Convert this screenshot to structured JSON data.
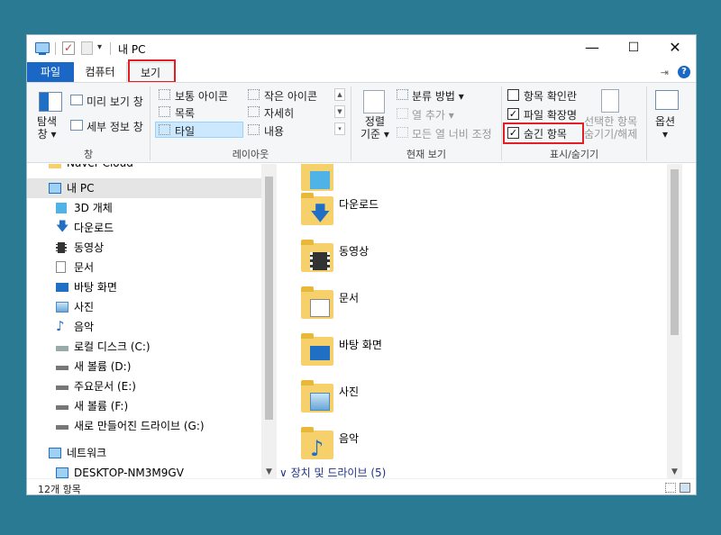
{
  "window": {
    "title": "내 PC"
  },
  "quick_access": {
    "pc_icon": "computer-icon",
    "check_icon": "checkmark-icon",
    "dropdown_glyph": "▾"
  },
  "controls": {
    "minimize": "—",
    "maximize": "☐",
    "close": "✕"
  },
  "tabs": [
    {
      "label": "파일",
      "active": false
    },
    {
      "label": "컴퓨터",
      "active": false
    },
    {
      "label": "보기",
      "active": true
    }
  ],
  "ribbon": {
    "pin_glyph": "⇥",
    "help_glyph": "?",
    "panes": {
      "nav_pane": "탐색\n창 ▾",
      "preview_pane": "미리 보기 창",
      "details_pane": "세부 정보 창",
      "group_label": "창"
    },
    "layout": {
      "items": [
        "보통 아이콘",
        "작은 아이콘",
        "목록",
        "자세히",
        "타일",
        "내용"
      ],
      "selected": "타일",
      "group_label": "레이아웃"
    },
    "current_view": {
      "sort_by": "정렬\n기준 ▾",
      "group_by": "분류 방법 ▾",
      "add_columns": "열 추가 ▾",
      "size_all_columns": "모든 열 너비 조정",
      "group_label": "현재 보기"
    },
    "show_hide": {
      "item_checkboxes": {
        "label": "항목 확인란",
        "checked": false
      },
      "file_extensions": {
        "label": "파일 확장명",
        "checked": true
      },
      "hidden_items": {
        "label": "숨긴 항목",
        "checked": true
      },
      "hide_selected": "선택한 항목\n숨기기/해제",
      "group_label": "표시/숨기기"
    },
    "options": "옵션\n▾"
  },
  "nav": {
    "partial_top": "Naver Cloud",
    "items": [
      {
        "label": "내 PC",
        "icon": "computer-icon",
        "selected": true
      },
      {
        "label": "3D 개체",
        "icon": "cube-icon"
      },
      {
        "label": "다운로드",
        "icon": "download-arrow-icon"
      },
      {
        "label": "동영상",
        "icon": "film-icon"
      },
      {
        "label": "문서",
        "icon": "document-icon"
      },
      {
        "label": "바탕 화면",
        "icon": "desktop-icon"
      },
      {
        "label": "사진",
        "icon": "picture-icon"
      },
      {
        "label": "음악",
        "icon": "music-note-icon"
      },
      {
        "label": "로컬 디스크 (C:)",
        "icon": "windows-drive-icon"
      },
      {
        "label": "새 볼륨 (D:)",
        "icon": "drive-icon"
      },
      {
        "label": "주요문서 (E:)",
        "icon": "drive-icon"
      },
      {
        "label": "새 볼륨 (F:)",
        "icon": "drive-icon"
      },
      {
        "label": "새로 만들어진 드라이브 (G:)",
        "icon": "drive-icon"
      },
      {
        "label": "네트워크",
        "icon": "network-icon"
      },
      {
        "label": "DESKTOP-NM3M9GV",
        "icon": "computer-icon"
      }
    ]
  },
  "content": {
    "folders": [
      {
        "label": "",
        "icon": "cube-icon"
      },
      {
        "label": "다운로드",
        "icon": "download-arrow-icon"
      },
      {
        "label": "동영상",
        "icon": "film-icon"
      },
      {
        "label": "문서",
        "icon": "document-icon"
      },
      {
        "label": "바탕 화면",
        "icon": "desktop-icon"
      },
      {
        "label": "사진",
        "icon": "picture-icon"
      },
      {
        "label": "음악",
        "icon": "music-note-icon"
      }
    ],
    "group_header": "∨ 장치 및 드라이브 (5)"
  },
  "status": {
    "item_count": "12개 항목"
  }
}
